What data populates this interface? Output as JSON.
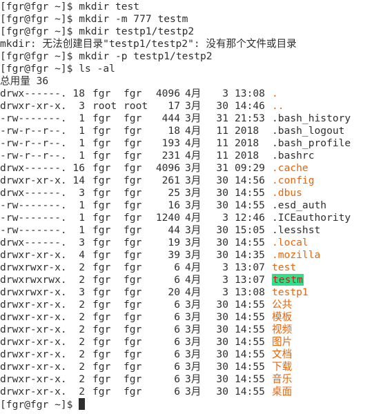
{
  "terminal": {
    "prompt": "[fgr@fgr ~]$ ",
    "colors": {
      "text": "#2e2e2e",
      "directory": "#e8650a",
      "highlight_bg": "#2ee08a",
      "highlight_fg": "#e01010",
      "background": "#ffffff"
    },
    "history": [
      {
        "type": "command",
        "text": "mkdir test"
      },
      {
        "type": "command",
        "text": "mkdir -m 777 testm"
      },
      {
        "type": "command",
        "text": "mkdir testp1/testp2"
      },
      {
        "type": "output",
        "text": "mkdir: 无法创建目录\"testp1/testp2\": 没有那个文件或目录"
      },
      {
        "type": "command",
        "text": "mkdir -p testp1/testp2"
      },
      {
        "type": "command",
        "text": "ls -al"
      },
      {
        "type": "output",
        "text": "总用量 36"
      }
    ],
    "listing": [
      {
        "perm": "drwx------.",
        "links": "18",
        "owner": "fgr",
        "group": "fgr",
        "size": "4096",
        "month": "4月",
        "day": "3",
        "time": "13:08",
        "name": ".",
        "kind": "dir"
      },
      {
        "perm": "drwxr-xr-x.",
        "links": "3",
        "owner": "root",
        "group": "root",
        "size": "17",
        "month": "3月",
        "day": "30",
        "time": "14:46",
        "name": "..",
        "kind": "dir"
      },
      {
        "perm": "-rw-------.",
        "links": "1",
        "owner": "fgr",
        "group": "fgr",
        "size": "444",
        "month": "3月",
        "day": "31",
        "time": "21:53",
        "name": ".bash_history",
        "kind": "file"
      },
      {
        "perm": "-rw-r--r--.",
        "links": "1",
        "owner": "fgr",
        "group": "fgr",
        "size": "18",
        "month": "4月",
        "day": "11",
        "time": "2018",
        "name": ".bash_logout",
        "kind": "file"
      },
      {
        "perm": "-rw-r--r--.",
        "links": "1",
        "owner": "fgr",
        "group": "fgr",
        "size": "193",
        "month": "4月",
        "day": "11",
        "time": "2018",
        "name": ".bash_profile",
        "kind": "file"
      },
      {
        "perm": "-rw-r--r--.",
        "links": "1",
        "owner": "fgr",
        "group": "fgr",
        "size": "231",
        "month": "4月",
        "day": "11",
        "time": "2018",
        "name": ".bashrc",
        "kind": "file"
      },
      {
        "perm": "drwx------.",
        "links": "16",
        "owner": "fgr",
        "group": "fgr",
        "size": "4096",
        "month": "3月",
        "day": "31",
        "time": "09:29",
        "name": ".cache",
        "kind": "dir"
      },
      {
        "perm": "drwxr-xr-x.",
        "links": "14",
        "owner": "fgr",
        "group": "fgr",
        "size": "261",
        "month": "3月",
        "day": "30",
        "time": "14:56",
        "name": ".config",
        "kind": "dir"
      },
      {
        "perm": "drwx------.",
        "links": "3",
        "owner": "fgr",
        "group": "fgr",
        "size": "25",
        "month": "3月",
        "day": "30",
        "time": "14:55",
        "name": ".dbus",
        "kind": "dir"
      },
      {
        "perm": "-rw-------.",
        "links": "1",
        "owner": "fgr",
        "group": "fgr",
        "size": "16",
        "month": "3月",
        "day": "30",
        "time": "14:55",
        "name": ".esd_auth",
        "kind": "file"
      },
      {
        "perm": "-rw-------.",
        "links": "1",
        "owner": "fgr",
        "group": "fgr",
        "size": "1240",
        "month": "4月",
        "day": "3",
        "time": "12:46",
        "name": ".ICEauthority",
        "kind": "file"
      },
      {
        "perm": "-rw-------.",
        "links": "1",
        "owner": "fgr",
        "group": "fgr",
        "size": "44",
        "month": "3月",
        "day": "30",
        "time": "15:05",
        "name": ".lesshst",
        "kind": "file"
      },
      {
        "perm": "drwx------.",
        "links": "3",
        "owner": "fgr",
        "group": "fgr",
        "size": "19",
        "month": "3月",
        "day": "30",
        "time": "14:55",
        "name": ".local",
        "kind": "dir"
      },
      {
        "perm": "drwxr-xr-x.",
        "links": "4",
        "owner": "fgr",
        "group": "fgr",
        "size": "39",
        "month": "3月",
        "day": "30",
        "time": "14:35",
        "name": ".mozilla",
        "kind": "dir"
      },
      {
        "perm": "drwxrwxr-x.",
        "links": "2",
        "owner": "fgr",
        "group": "fgr",
        "size": "6",
        "month": "4月",
        "day": "3",
        "time": "13:07",
        "name": "test",
        "kind": "dir"
      },
      {
        "perm": "drwxrwxrwx.",
        "links": "2",
        "owner": "fgr",
        "group": "fgr",
        "size": "6",
        "month": "4月",
        "day": "3",
        "time": "13:07",
        "name": "testm",
        "kind": "world-writable-dir"
      },
      {
        "perm": "drwxrwxr-x.",
        "links": "3",
        "owner": "fgr",
        "group": "fgr",
        "size": "20",
        "month": "4月",
        "day": "3",
        "time": "13:08",
        "name": "testp1",
        "kind": "dir"
      },
      {
        "perm": "drwxr-xr-x.",
        "links": "2",
        "owner": "fgr",
        "group": "fgr",
        "size": "6",
        "month": "3月",
        "day": "30",
        "time": "14:55",
        "name": "公共",
        "kind": "dir"
      },
      {
        "perm": "drwxr-xr-x.",
        "links": "2",
        "owner": "fgr",
        "group": "fgr",
        "size": "6",
        "month": "3月",
        "day": "30",
        "time": "14:55",
        "name": "模板",
        "kind": "dir"
      },
      {
        "perm": "drwxr-xr-x.",
        "links": "2",
        "owner": "fgr",
        "group": "fgr",
        "size": "6",
        "month": "3月",
        "day": "30",
        "time": "14:55",
        "name": "视频",
        "kind": "dir"
      },
      {
        "perm": "drwxr-xr-x.",
        "links": "2",
        "owner": "fgr",
        "group": "fgr",
        "size": "6",
        "month": "3月",
        "day": "30",
        "time": "14:55",
        "name": "图片",
        "kind": "dir"
      },
      {
        "perm": "drwxr-xr-x.",
        "links": "2",
        "owner": "fgr",
        "group": "fgr",
        "size": "6",
        "month": "3月",
        "day": "30",
        "time": "14:55",
        "name": "文档",
        "kind": "dir"
      },
      {
        "perm": "drwxr-xr-x.",
        "links": "2",
        "owner": "fgr",
        "group": "fgr",
        "size": "6",
        "month": "3月",
        "day": "30",
        "time": "14:55",
        "name": "下载",
        "kind": "dir"
      },
      {
        "perm": "drwxr-xr-x.",
        "links": "2",
        "owner": "fgr",
        "group": "fgr",
        "size": "6",
        "month": "3月",
        "day": "30",
        "time": "14:55",
        "name": "音乐",
        "kind": "dir"
      },
      {
        "perm": "drwxr-xr-x.",
        "links": "2",
        "owner": "fgr",
        "group": "fgr",
        "size": "6",
        "month": "3月",
        "day": "30",
        "time": "14:55",
        "name": "桌面",
        "kind": "dir"
      }
    ],
    "current_input": ""
  }
}
